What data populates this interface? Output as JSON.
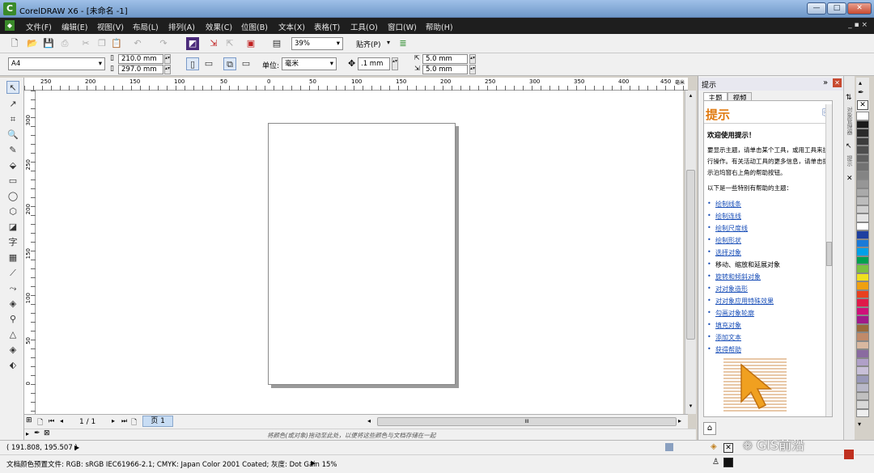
{
  "window": {
    "title": "CorelDRAW X6 - [未命名 -1]",
    "logo": "C",
    "minimize": "—",
    "maximize": "□",
    "close": "✕"
  },
  "menu": [
    "文件(F)",
    "编辑(E)",
    "视图(V)",
    "布局(L)",
    "排列(A)",
    "效果(C)",
    "位图(B)",
    "文本(X)",
    "表格(T)",
    "工具(O)",
    "窗口(W)",
    "帮助(H)"
  ],
  "menu_doc_controls": "_ ▪ ×",
  "toolbar": {
    "zoom": "39%",
    "snap_label": "贴齐(P)"
  },
  "propbar": {
    "page_size": "A4",
    "width": "210.0 mm",
    "height": "297.0 mm",
    "unit_label": "单位:",
    "unit_value": "毫米",
    "nudge": ".1 mm",
    "dup_x": "5.0 mm",
    "dup_y": "5.0 mm"
  },
  "ruler": {
    "top_ticks": [
      "250",
      "200",
      "150",
      "100",
      "50",
      "0",
      "50",
      "100",
      "150",
      "200",
      "250",
      "300",
      "350",
      "400",
      "450"
    ],
    "top_unit": "毫米",
    "left_ticks": [
      "300",
      "250",
      "200",
      "150",
      "100",
      "50",
      "0"
    ]
  },
  "pagenav": {
    "counter": "1 / 1",
    "tab": "页 1"
  },
  "color_hint": "将颜色(或对象)拖动至此处，以便将这些颜色与文档存储在一起",
  "status": {
    "coords": "( 191.808, 195.507 )",
    "color_profile": "文档颜色预置文件: RGB: sRGB IEC61966-2.1; CMYK: Japan Color 2001 Coated; 灰度: Dot Gain 15%"
  },
  "docker": {
    "header": "提示",
    "tabs": [
      "主题",
      "视频"
    ],
    "heading": "提示",
    "welcome": "欢迎使用提示！",
    "intro": "要显示主题，请单击某个工具，或用工具来执行操作。有关活动工具的更多信息，请单击提示泊坞窗右上角的帮助按钮。",
    "list_title": "以下是一些特别有帮助的主题：",
    "links": [
      "绘制线条",
      "绘制连线",
      "绘制尺度线",
      "绘制形状",
      "选择对象",
      "移动、缩放和延展对象",
      "旋转和倾斜对象",
      "对对象造形",
      "对对象应用特殊效果",
      "勾画对象轮廓",
      "填充对象",
      "添加文本",
      "获得帮助"
    ]
  },
  "side_tabs": [
    "对象管理器",
    "提示"
  ],
  "watermark": "GIS前沿",
  "palette_colors": [
    "#ffffff",
    "#1a1a1a",
    "#2a2a2a",
    "#3c3c3c",
    "#4e4e4e",
    "#606060",
    "#727272",
    "#848484",
    "#969696",
    "#aaaaaa",
    "#bcbcbc",
    "#d0d0d0",
    "#e4e4e4",
    "#ffffff",
    "#1e3fa0",
    "#1a7ad8",
    "#00a0e8",
    "#00a050",
    "#7cc040",
    "#f0e020",
    "#f0a010",
    "#e84020",
    "#e01a4a",
    "#d0107a",
    "#a01a8a",
    "#9a6a3a",
    "#c08a6a",
    "#d8b8a0",
    "#8a6aa0",
    "#b0a0c8",
    "#c8c0d8",
    "#9898b8",
    "#b8b8c8",
    "#c0c0c0",
    "#d8d8d8",
    "#eeeeee"
  ]
}
